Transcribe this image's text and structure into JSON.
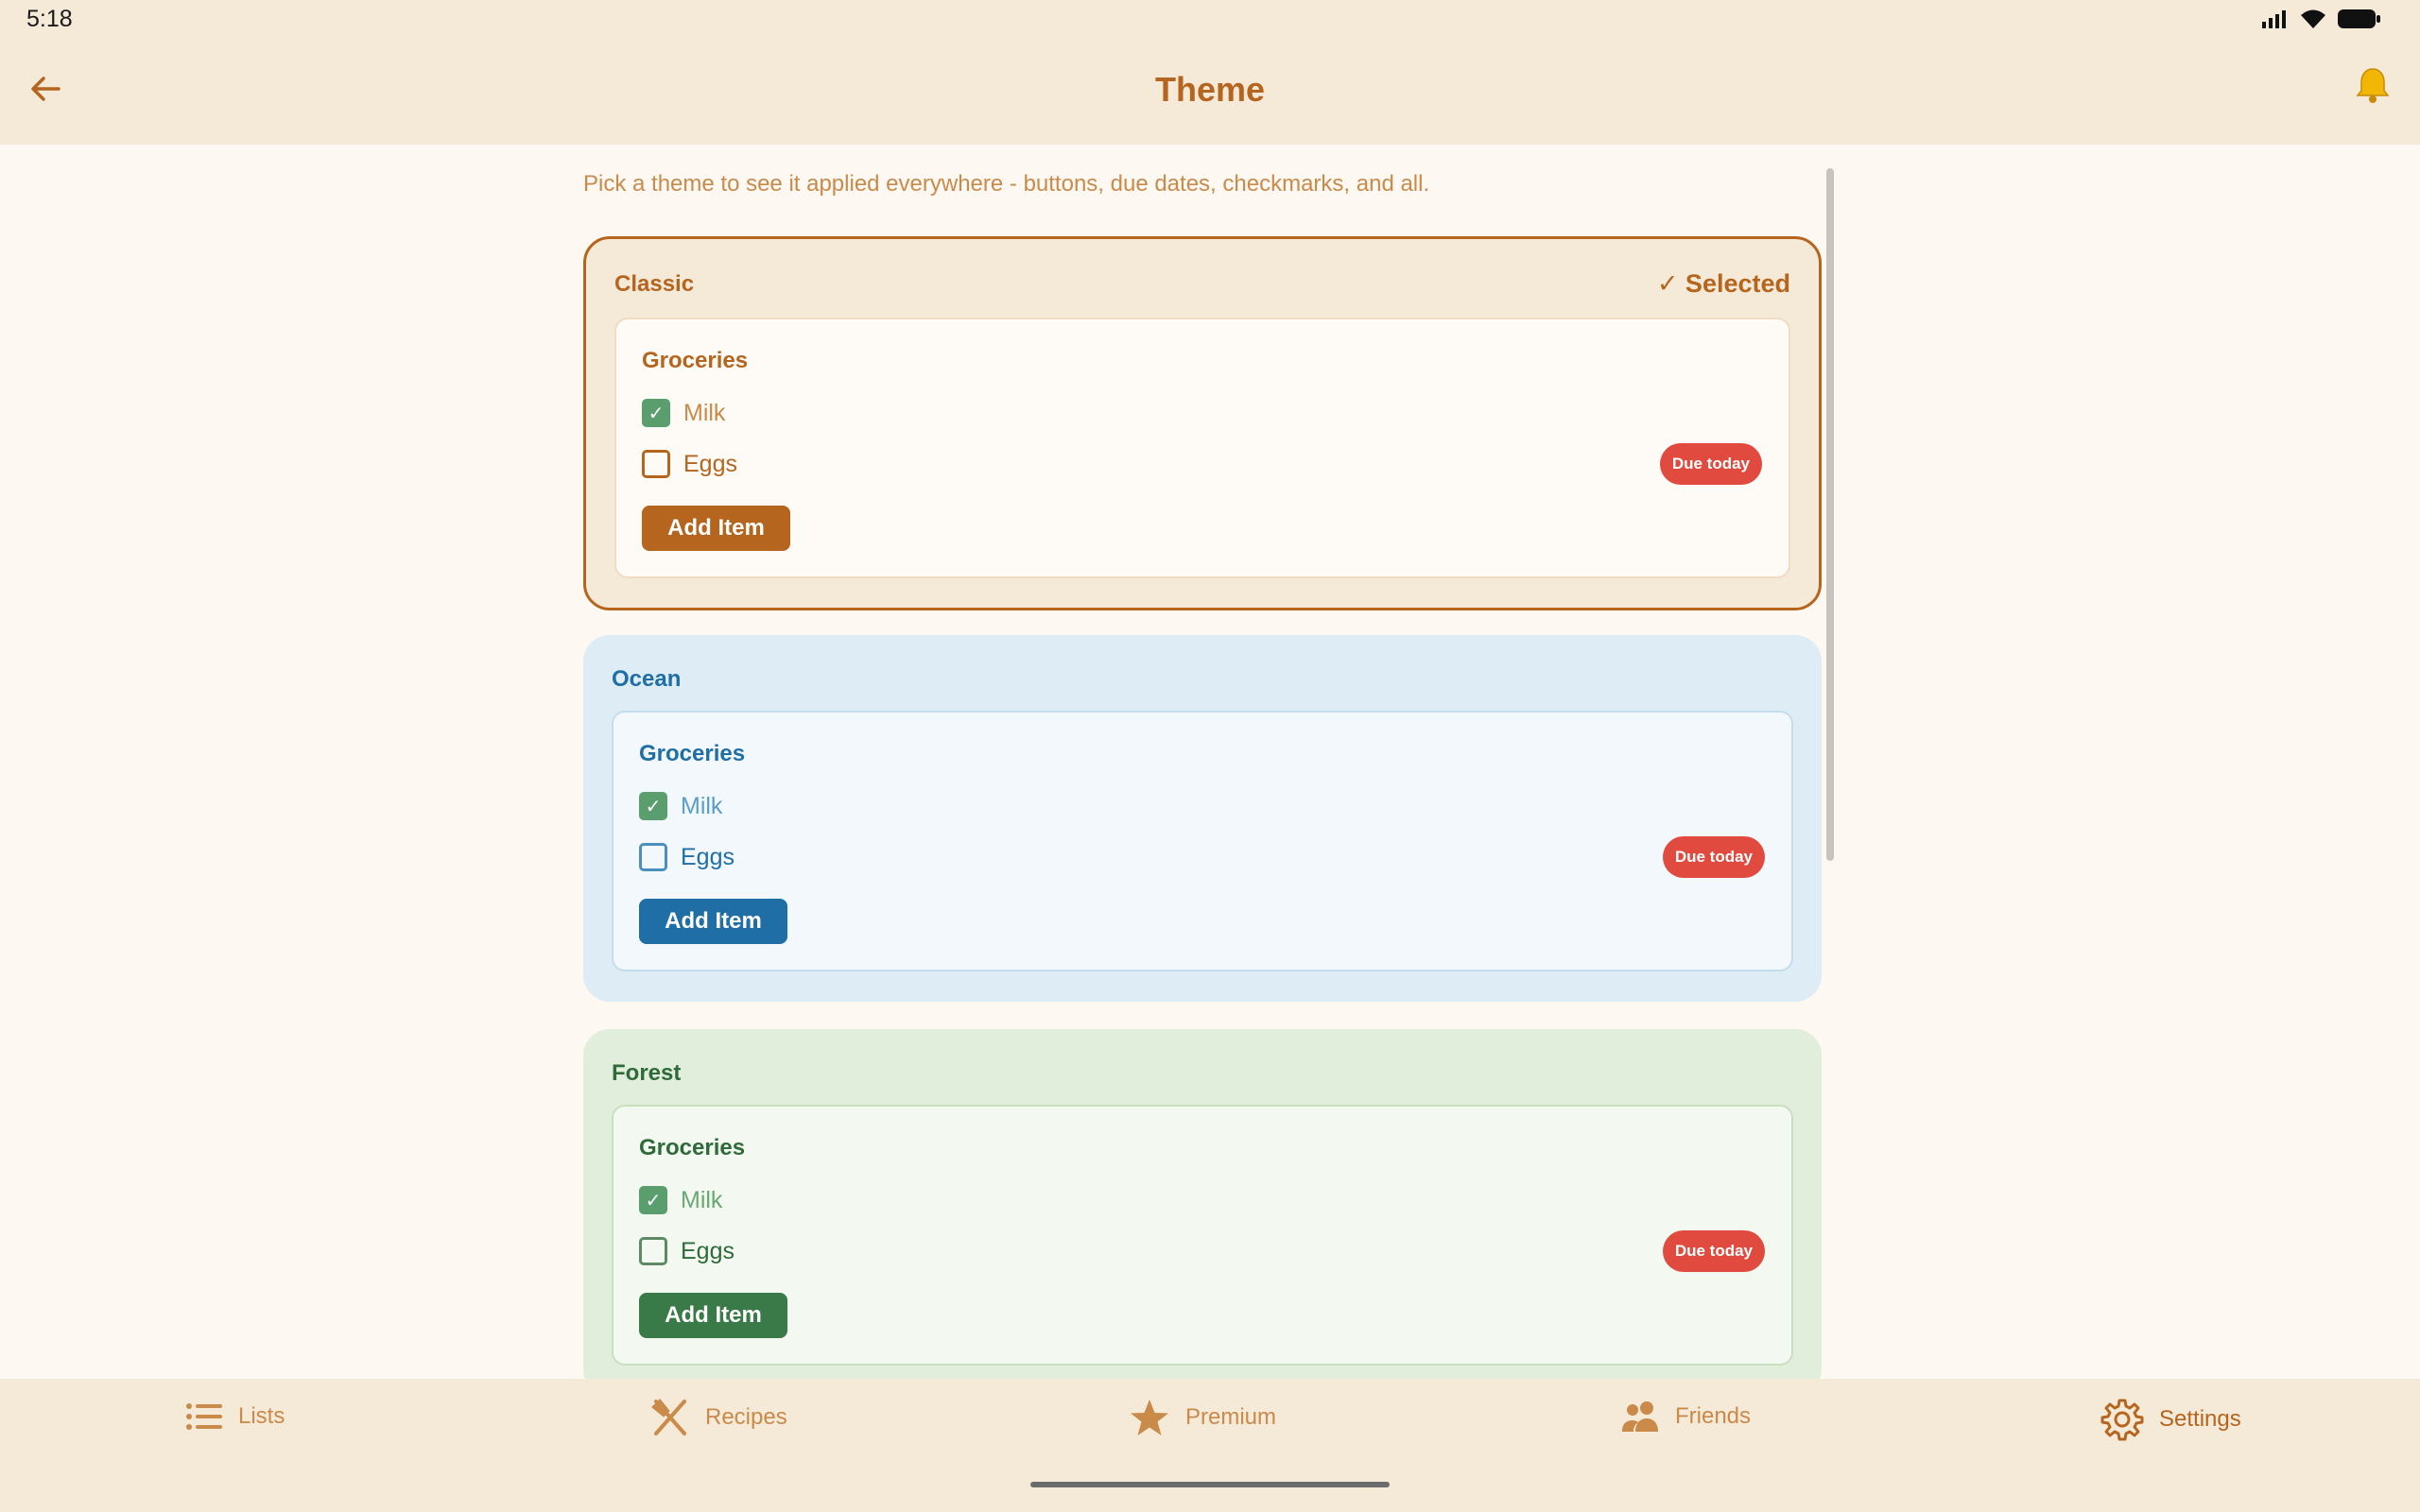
{
  "status": {
    "time": "5:18"
  },
  "header": {
    "title": "Theme"
  },
  "intro": "Pick a theme to see it applied everywhere - buttons, due dates, checkmarks, and all.",
  "themes": [
    {
      "name": "Classic",
      "selected_label": "✓ Selected",
      "colors": {
        "card_bg": "#f5e9d8",
        "preview_bg": "#fefbf6",
        "preview_border": "#f0dcc2",
        "title": "#b5651d",
        "text": "#b5651d",
        "muted": "#c98a4a",
        "checkbox_border": "#b5651d",
        "button": "#b5651d"
      }
    },
    {
      "name": "Ocean",
      "colors": {
        "card_bg": "#ddecf5",
        "preview_bg": "#f2f8fc",
        "preview_border": "#c4dded",
        "title": "#1f6ea6",
        "text": "#1f6ea6",
        "muted": "#5a9ec7",
        "checkbox_border": "#4b8fc0",
        "button": "#1f6ea6"
      }
    },
    {
      "name": "Forest",
      "colors": {
        "card_bg": "#e0eedb",
        "preview_bg": "#f3f9f1",
        "preview_border": "#c8e0c0",
        "title": "#2f6b3a",
        "text": "#2f6b3a",
        "muted": "#6aa872",
        "checkbox_border": "#5d8a64",
        "button": "#3a7a48"
      }
    }
  ],
  "preview": {
    "list_title": "Groceries",
    "item_checked": "Milk",
    "item_unchecked": "Eggs",
    "due_label": "Due today",
    "add_button": "Add Item"
  },
  "nav": {
    "lists": "Lists",
    "recipes": "Recipes",
    "premium": "Premium",
    "friends": "Friends",
    "settings": "Settings",
    "active": "settings"
  }
}
